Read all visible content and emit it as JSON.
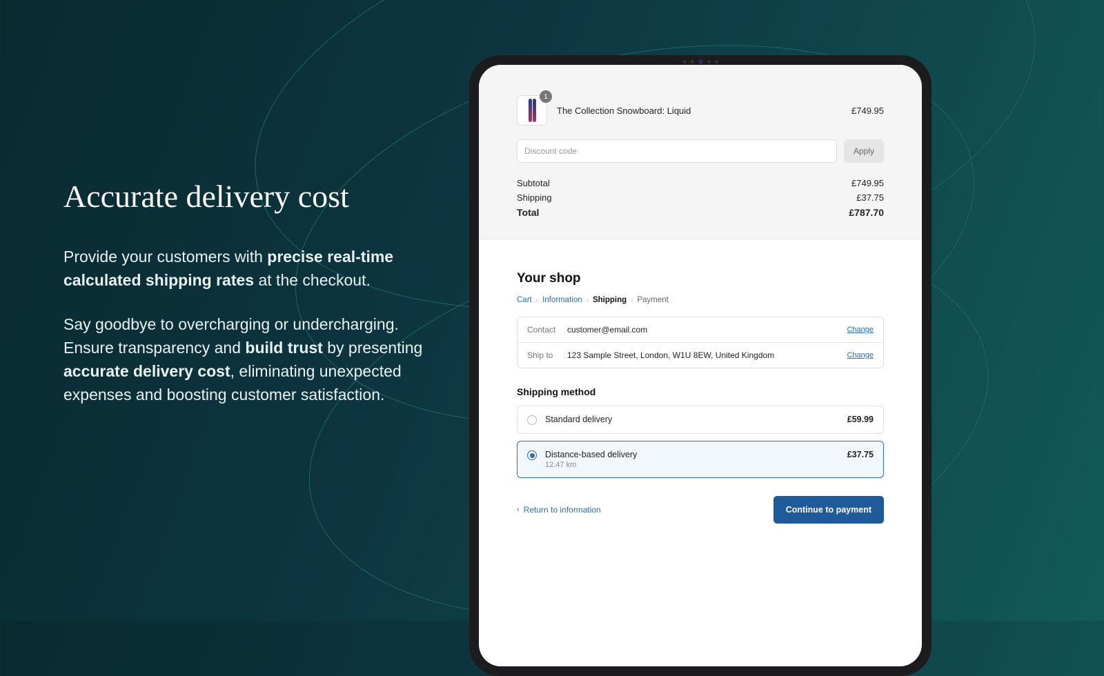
{
  "marketing": {
    "heading": "Accurate delivery cost",
    "p1a": "Provide your customers with ",
    "p1b": "precise real-time calculated shipping rates",
    "p1c": " at the checkout.",
    "p2a": "Say goodbye to overcharging or undercharging. Ensure transparency and ",
    "p2b": "build trust",
    "p2c": " by presenting ",
    "p2d": "accurate delivery cost",
    "p2e": ", eliminating unexpected expenses and boosting customer satisfaction."
  },
  "summary": {
    "product_name": "The Collection Snowboard: Liquid",
    "product_qty": "1",
    "product_price": "£749.95",
    "discount_placeholder": "Discount code",
    "apply_label": "Apply",
    "subtotal_label": "Subtotal",
    "subtotal_value": "£749.95",
    "shipping_label": "Shipping",
    "shipping_value": "£37.75",
    "total_label": "Total",
    "total_value": "£787.70"
  },
  "checkout": {
    "shop_title": "Your shop",
    "crumbs": {
      "cart": "Cart",
      "information": "Information",
      "shipping": "Shipping",
      "payment": "Payment"
    },
    "contact_label": "Contact",
    "contact_value": "customer@email.com",
    "shipto_label": "Ship to",
    "shipto_value": "123 Sample Street, London, W1U 8EW, United Kingdom",
    "change_label": "Change",
    "shipping_method_title": "Shipping method",
    "options": [
      {
        "name": "Standard delivery",
        "sub": "",
        "price": "£59.99"
      },
      {
        "name": "Distance-based delivery",
        "sub": "12.47 km",
        "price": "£37.75"
      }
    ],
    "return_label": "Return to information",
    "continue_label": "Continue to payment"
  }
}
